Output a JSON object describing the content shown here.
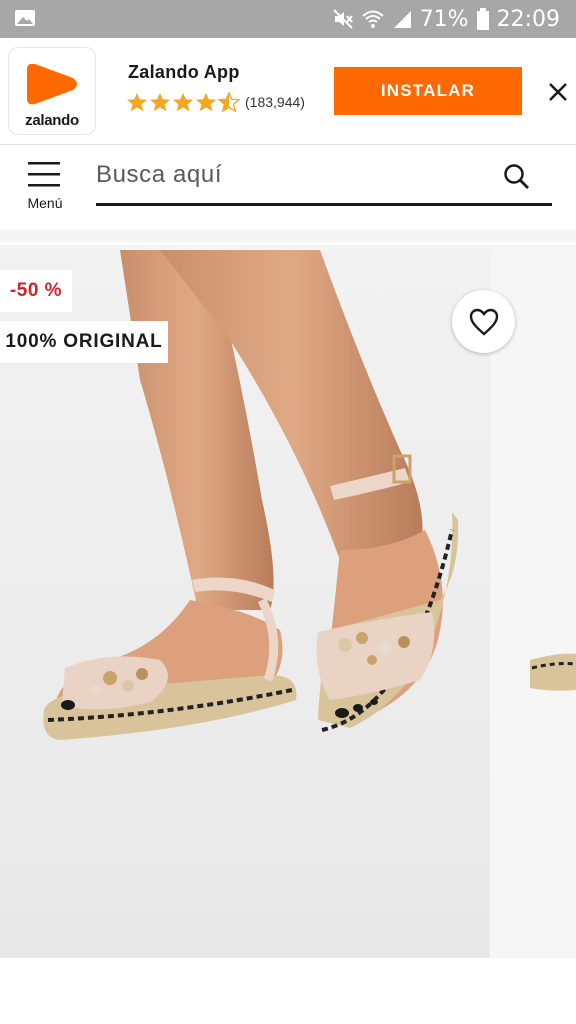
{
  "status_bar": {
    "battery": "71%",
    "time": "22:09",
    "icons": [
      "gallery-icon",
      "mute-icon",
      "wifi-icon",
      "signal-icon",
      "battery-icon"
    ]
  },
  "app_banner": {
    "logo_text": "zalando",
    "app_name": "Zalando App",
    "rating": 4.5,
    "rating_count": "(183,944)",
    "install_label": "INSTALAR",
    "accent_color": "#ff6900"
  },
  "header": {
    "menu_label": "Menú",
    "search_placeholder": "Busca aquí"
  },
  "product": {
    "discount_badge": "-50 %",
    "original_badge": "100% ORIGINAL",
    "discount_color": "#d2232a"
  }
}
